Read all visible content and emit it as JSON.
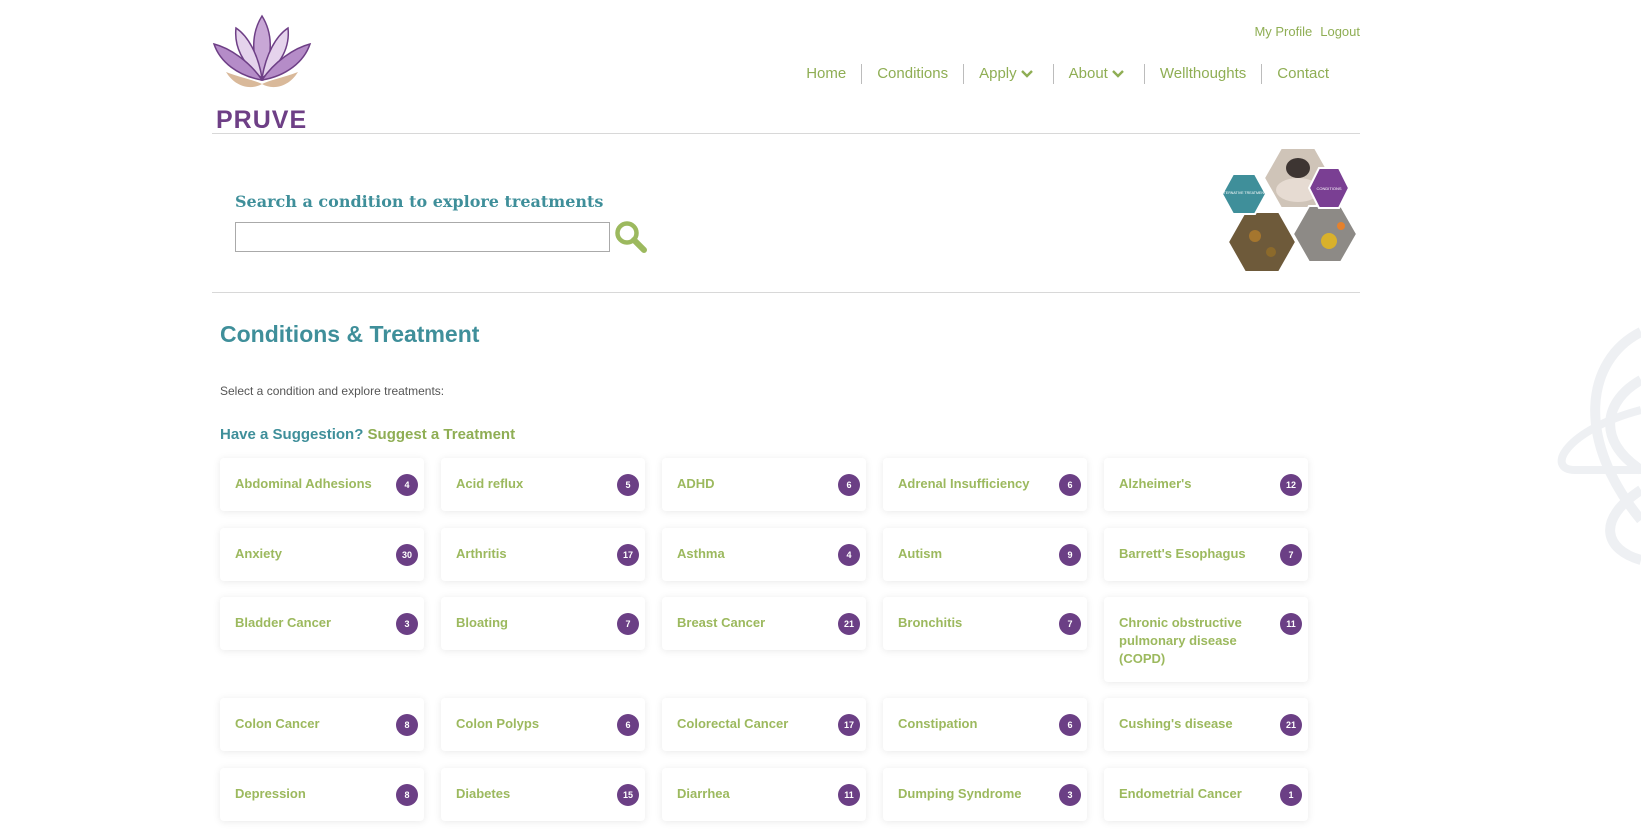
{
  "brand": {
    "name": "PRUVE"
  },
  "header": {
    "top_links": [
      "My Profile",
      "Logout"
    ],
    "nav": [
      {
        "label": "Home",
        "dropdown": false
      },
      {
        "label": "Conditions",
        "dropdown": false
      },
      {
        "label": "Apply",
        "dropdown": true
      },
      {
        "label": "About",
        "dropdown": true
      },
      {
        "label": "Wellthoughts",
        "dropdown": false
      },
      {
        "label": "Contact",
        "dropdown": false
      }
    ]
  },
  "search": {
    "title": "Search a condition to explore treatments",
    "value": "",
    "hex_labels": [
      "ALTERNATIVE TREATMENTS",
      "CONDITIONS"
    ]
  },
  "main": {
    "title": "Conditions & Treatment",
    "intro": "Select a condition and explore treatments:",
    "suggest_prefix": "Have a Suggestion?",
    "suggest_link": "Suggest a Treatment"
  },
  "conditions": [
    {
      "name": "Abdominal Adhesions",
      "count": "4"
    },
    {
      "name": "Acid reflux",
      "count": "5"
    },
    {
      "name": "ADHD",
      "count": "6"
    },
    {
      "name": "Adrenal Insufficiency",
      "count": "6"
    },
    {
      "name": "Alzheimer's",
      "count": "12"
    },
    {
      "name": "Anxiety",
      "count": "30"
    },
    {
      "name": "Arthritis",
      "count": "17"
    },
    {
      "name": "Asthma",
      "count": "4"
    },
    {
      "name": "Autism",
      "count": "9"
    },
    {
      "name": "Barrett's Esophagus",
      "count": "7"
    },
    {
      "name": "Bladder Cancer",
      "count": "3"
    },
    {
      "name": "Bloating",
      "count": "7"
    },
    {
      "name": "Breast Cancer",
      "count": "21"
    },
    {
      "name": "Bronchitis",
      "count": "7"
    },
    {
      "name": "Chronic obstructive pulmonary disease (COPD)",
      "count": "11"
    },
    {
      "name": "Colon Cancer",
      "count": "8"
    },
    {
      "name": "Colon Polyps",
      "count": "6"
    },
    {
      "name": "Colorectal Cancer",
      "count": "17"
    },
    {
      "name": "Constipation",
      "count": "6"
    },
    {
      "name": "Cushing's disease",
      "count": "21"
    },
    {
      "name": "Depression",
      "count": "8"
    },
    {
      "name": "Diabetes",
      "count": "15"
    },
    {
      "name": "Diarrhea",
      "count": "11"
    },
    {
      "name": "Dumping Syndrome",
      "count": "3"
    },
    {
      "name": "Endometrial Cancer",
      "count": "1"
    }
  ],
  "colors": {
    "teal": "#3f8f9a",
    "green": "#8fae54",
    "purple": "#6b3f85"
  }
}
